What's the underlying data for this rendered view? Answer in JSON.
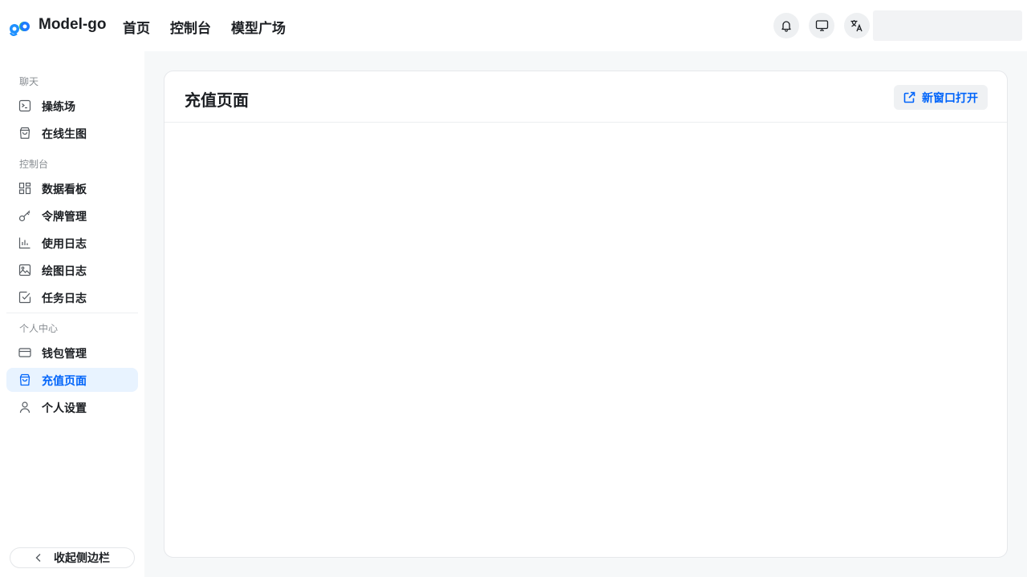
{
  "header": {
    "brand": "Model-go",
    "nav": [
      "首页",
      "控制台",
      "模型广场"
    ],
    "icons": [
      "bell-icon",
      "monitor-icon",
      "translate-icon"
    ]
  },
  "sidebar": {
    "groups": [
      {
        "title": "聊天",
        "items": [
          {
            "label": "操练场",
            "icon": "terminal-icon"
          },
          {
            "label": "在线生图",
            "icon": "bag-icon"
          }
        ]
      },
      {
        "title": "控制台",
        "items": [
          {
            "label": "数据看板",
            "icon": "dashboard-icon"
          },
          {
            "label": "令牌管理",
            "icon": "key-icon"
          },
          {
            "label": "使用日志",
            "icon": "chart-icon"
          },
          {
            "label": "绘图日志",
            "icon": "image-icon"
          },
          {
            "label": "任务日志",
            "icon": "checkbox-icon"
          }
        ]
      },
      {
        "title": "个人中心",
        "items": [
          {
            "label": "钱包管理",
            "icon": "card-icon"
          },
          {
            "label": "充值页面",
            "icon": "bag-icon",
            "active": true
          },
          {
            "label": "个人设置",
            "icon": "user-icon"
          }
        ]
      }
    ],
    "collapse_label": "收起侧边栏"
  },
  "main": {
    "title": "充值页面",
    "open_new_window": "新窗口打开"
  },
  "colors": {
    "accent": "#0064fa",
    "active_bg": "#e8f3ff",
    "main_bg": "#f6f8f9"
  }
}
